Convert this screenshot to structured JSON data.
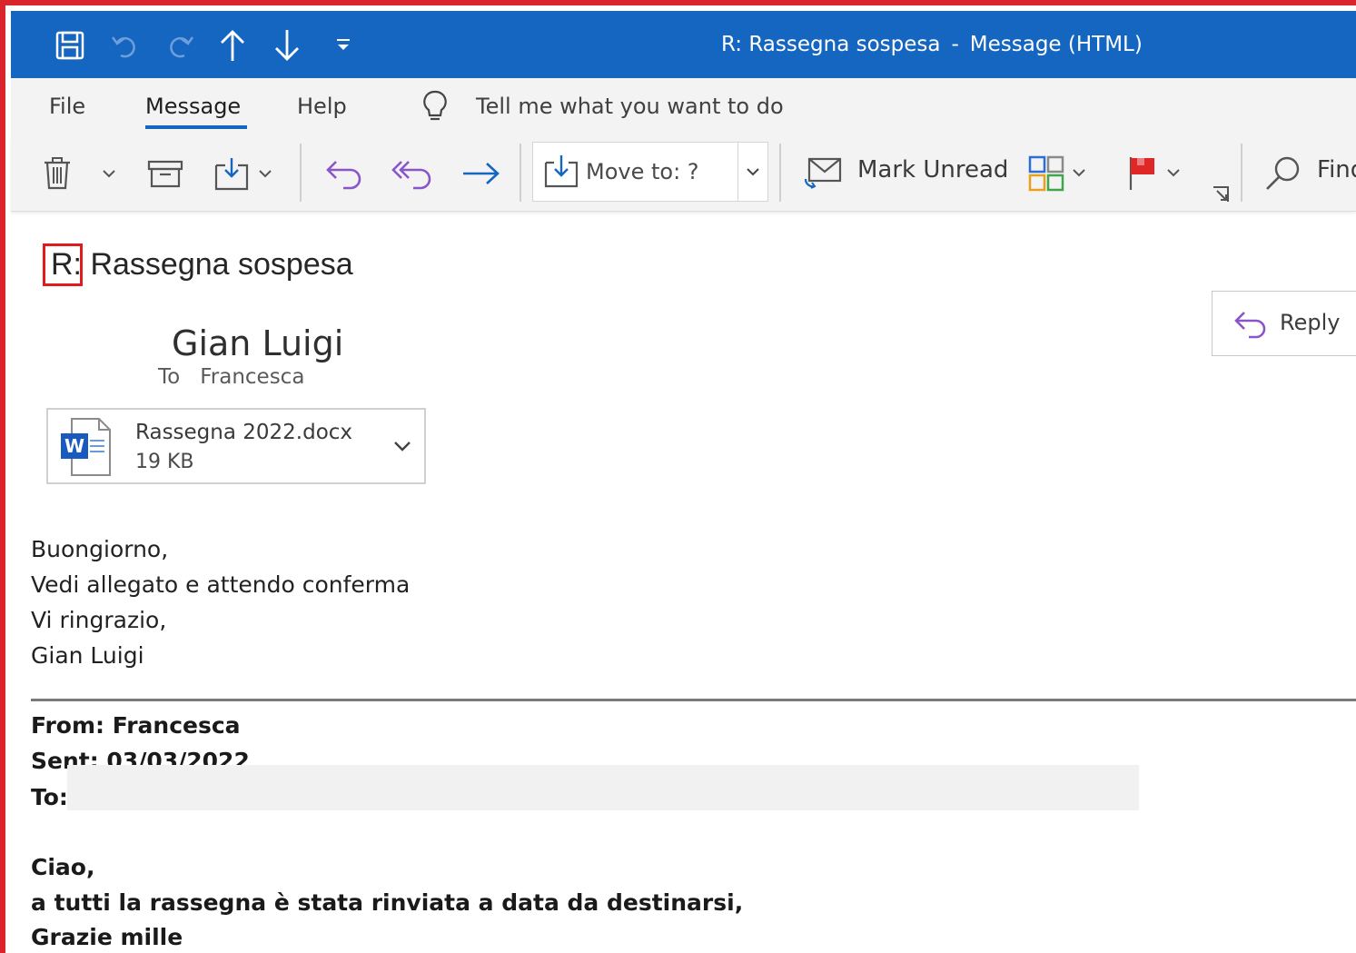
{
  "window": {
    "title": "R: Rassegna sospesa",
    "title_sep": "-",
    "title_mode": "Message (HTML)",
    "accent_color": "#1566c0",
    "frame_color": "#d9252b"
  },
  "quick_access": [
    "save-icon",
    "undo-icon",
    "redo-icon",
    "arrow-up-icon",
    "arrow-down-icon",
    "customize-icon"
  ],
  "menu": {
    "file": "File",
    "message": "Message",
    "help": "Help",
    "tell_me": "Tell me what you want to do"
  },
  "ribbon": {
    "move_to": "Move to: ?",
    "mark_unread": "Mark Unread",
    "find": "Find"
  },
  "message": {
    "subject_prefix": "R:",
    "subject_rest": "Rassegna sospesa",
    "sender": "Gian Luigi",
    "to_label": "To",
    "to_name": "Francesca",
    "reply_label": "Reply",
    "attachment": {
      "name": "Rassegna 2022.docx",
      "size": "19 KB"
    },
    "body": [
      "Buongiorno,",
      "Vedi allegato e attendo conferma",
      "Vi ringrazio,",
      "Gian Luigi"
    ],
    "quoted": {
      "from": "From: Francesca",
      "sent": "Sent: 03/03/2022",
      "to": "To:",
      "body": [
        "Ciao,",
        "a tutti la rassegna è stata rinviata a data da destinarsi,",
        "Grazie mille"
      ]
    }
  }
}
